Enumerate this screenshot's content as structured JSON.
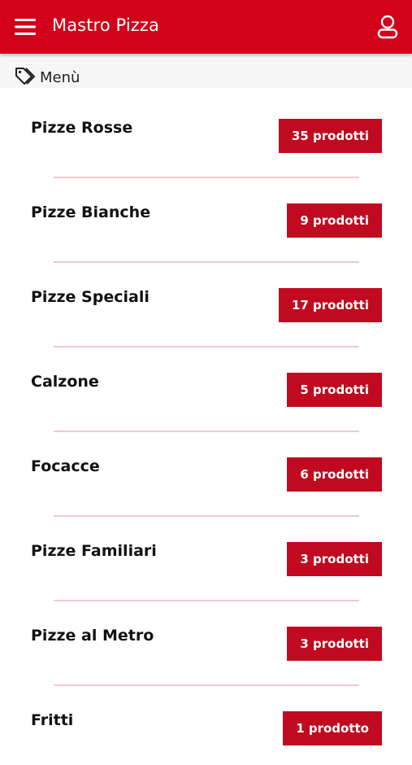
{
  "app": {
    "title": "Mastro Pizza"
  },
  "header": {
    "menu_icon": "hamburger-menu-icon",
    "user_icon": "user-account-icon"
  },
  "breadcrumb": {
    "icon": "tag-icon",
    "label": "Menù"
  },
  "colors": {
    "primary": "#d3001a",
    "badge": "#c10a1f",
    "divider": "#f3c8cf"
  },
  "categories": [
    {
      "name": "Pizze Rosse",
      "count": "35 prodotti"
    },
    {
      "name": "Pizze Bianche",
      "count": "9 prodotti"
    },
    {
      "name": "Pizze Speciali",
      "count": "17 prodotti"
    },
    {
      "name": "Calzone",
      "count": "5 prodotti"
    },
    {
      "name": "Focacce",
      "count": "6 prodotti"
    },
    {
      "name": "Pizze Familiari",
      "count": "3 prodotti"
    },
    {
      "name": "Pizze al Metro",
      "count": "3 prodotti"
    },
    {
      "name": "Fritti",
      "count": "1 prodotto"
    }
  ]
}
